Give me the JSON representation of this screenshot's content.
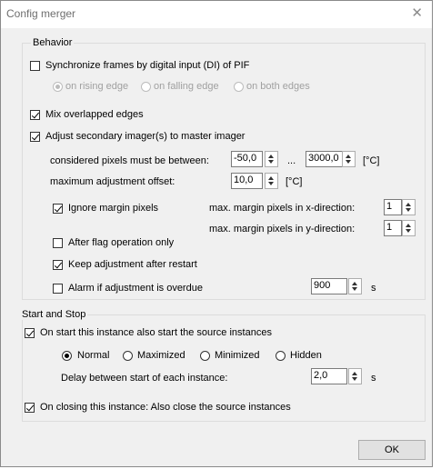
{
  "window": {
    "title": "Config merger"
  },
  "behavior": {
    "legend": "Behavior",
    "sync_label": "Synchronize frames by digital input (DI) of PIF",
    "sync_checked": false,
    "edge_options": [
      "on rising edge",
      "on falling edge",
      "on both edges"
    ],
    "edge_selected": "on rising edge",
    "mix_label": "Mix overlapped edges",
    "mix_checked": true,
    "adjust_label": "Adjust secondary imager(s) to master imager",
    "adjust_checked": true,
    "pixels_between_label": "considered pixels must be between:",
    "pixels_min": "-50,0",
    "range_sep": "...",
    "pixels_max": "3000,0",
    "unit_c": "[°C]",
    "max_offset_label": "maximum adjustment offset:",
    "max_offset": "10,0",
    "ignore_margin_label": "Ignore margin pixels",
    "ignore_margin_checked": true,
    "margin_x_label": "max. margin pixels in x-direction:",
    "margin_x": "1",
    "margin_y_label": "max. margin pixels in y-direction:",
    "margin_y": "1",
    "after_flag_label": "After flag operation only",
    "after_flag_checked": false,
    "keep_adjust_label": "Keep adjustment after restart",
    "keep_adjust_checked": true,
    "alarm_label": "Alarm if adjustment is overdue",
    "alarm_checked": false,
    "alarm_value": "900",
    "unit_s": "s"
  },
  "start_stop": {
    "legend": "Start and Stop",
    "on_start_label": "On start this instance also start the source instances",
    "on_start_checked": true,
    "window_modes": [
      "Normal",
      "Maximized",
      "Minimized",
      "Hidden"
    ],
    "window_mode_selected": "Normal",
    "delay_label": "Delay between start of each instance:",
    "delay_value": "2,0",
    "unit_s": "s",
    "on_close_label": "On closing this instance: Also close the source instances",
    "on_close_checked": true
  },
  "footer": {
    "ok_label": "OK"
  }
}
